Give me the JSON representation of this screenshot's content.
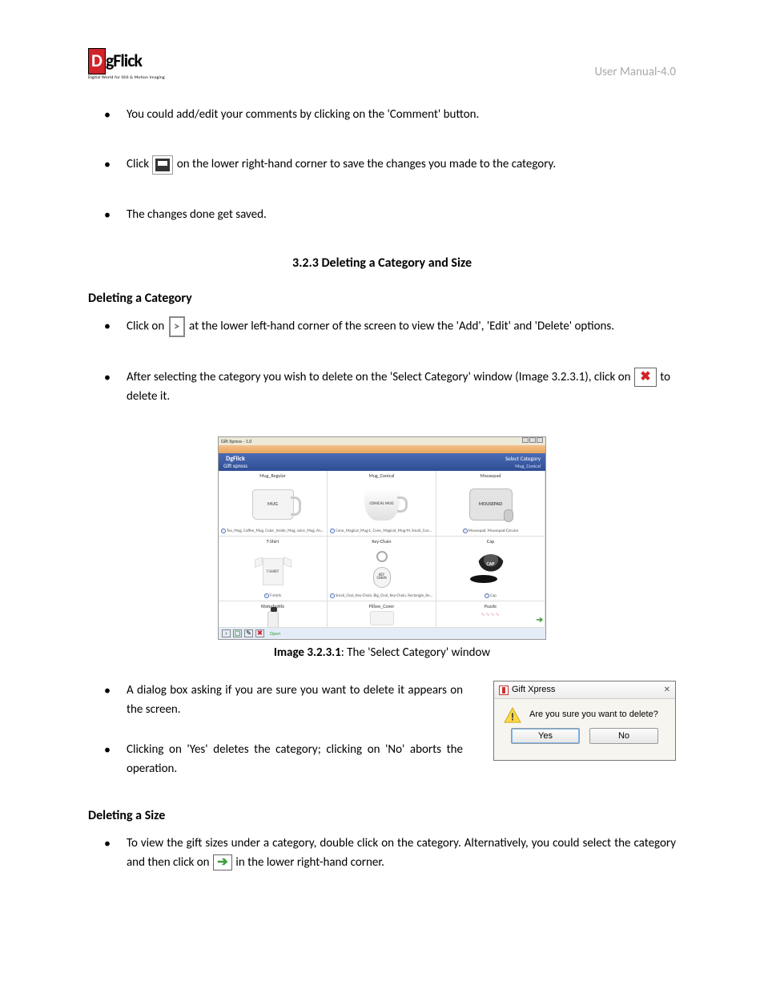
{
  "header": {
    "logo_text": "gFlick",
    "logo_tagline": "Digital World for Still & Motion Imaging",
    "version": "User Manual-4.0"
  },
  "bullets_top": [
    "You could add/edit your comments by clicking on the 'Comment' button.",
    {
      "pre": "Click",
      "post": "on the lower right-hand corner to save the changes you made to the category."
    },
    "The changes done get saved."
  ],
  "section_title": "3.2.3 Deleting a Category and Size",
  "deleting_category": {
    "heading": "Deleting a Category",
    "b1_pre": "Click on",
    "b1_post": "at the lower left-hand corner of the screen to view the 'Add', 'Edit' and 'Delete' options.",
    "b2_pre": "After selecting the category you wish to delete on the 'Select Category' window (Image 3.2.3.1), click on",
    "b2_post": "to delete it."
  },
  "figure": {
    "caption_bold": "Image 3.2.3.1",
    "caption_rest": ": The 'Select Category' window",
    "window_title": "Gift Xpress - 1.0",
    "brand": "DgFlick",
    "subbrand": "Gift xpress",
    "breadcrumb_top": "Select Category",
    "breadcrumb_sub": "Mug_Conical",
    "open_label": "Open",
    "cells": {
      "c1": {
        "label": "Mug_Regular",
        "obj": "MUG",
        "foot": "Tea_Mug, Coffee_Mug, Color_Inside_Mug, Juice_Mug, Animal_Mug, ..."
      },
      "c2": {
        "label": "Mug_Conical",
        "obj": "CONICAL MUG",
        "foot": "Cone_Magical_Mug-L, Cone_Magical_Mug-M, Small_Cone_Mug, Con..."
      },
      "c3": {
        "label": "Mousepad",
        "obj": "MOUSEPAD",
        "foot": "Mousepad, Mousepad-Circular"
      },
      "c4": {
        "label": "T-Shirt",
        "obj": "T-SHIRT",
        "foot": "T-shirts"
      },
      "c5": {
        "label": "Key-Chain",
        "obj": "KEY CHAIN",
        "foot": "Small_Oval_Key-Chain, Big_Oval_Key-Chain, Rectangle_Key-Chain, H..."
      },
      "c6": {
        "label": "Cap",
        "obj": "CAP",
        "foot": "Cap"
      },
      "c7": {
        "label": "Waterbottle"
      },
      "c8": {
        "label": "Pillow_Cover"
      },
      "c9": {
        "label": "Puzzle"
      }
    }
  },
  "dialog_bullets": {
    "b1": "A dialog box asking if you are sure you want to delete it appears on the screen.",
    "b2": "Clicking on 'Yes' deletes the category; clicking on 'No' aborts the operation."
  },
  "dialog": {
    "title": "Gift Xpress",
    "message": "Are you sure you want to delete?",
    "yes": "Yes",
    "no": "No"
  },
  "deleting_size": {
    "heading": "Deleting a Size",
    "b1_pre": "To view the gift sizes under a category, double click on the category. Alternatively, you could select the category and then click on",
    "b1_post": "in the lower right-hand corner."
  }
}
